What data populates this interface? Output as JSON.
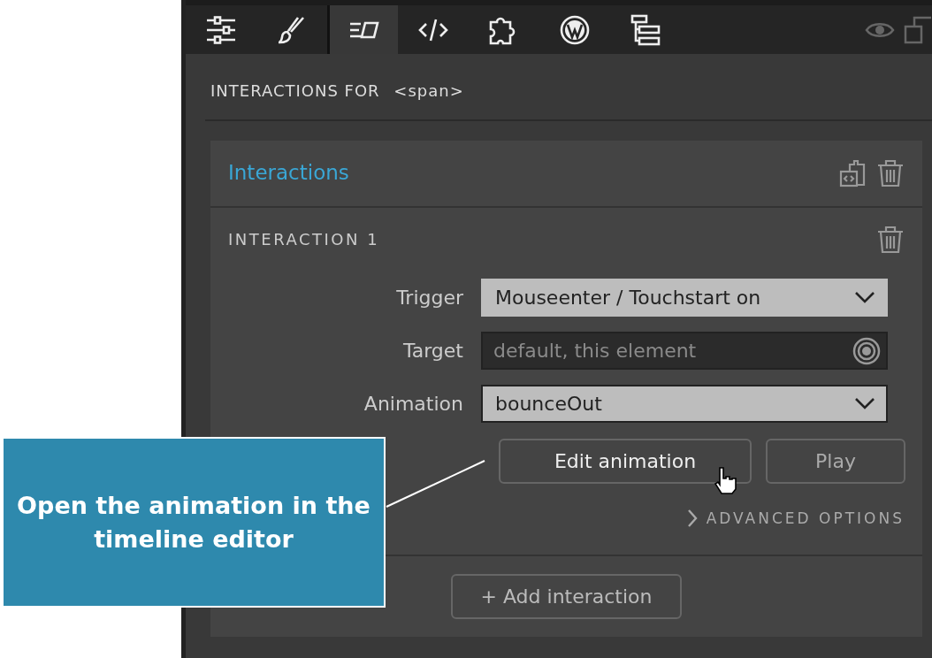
{
  "toolbar": {
    "tabs": [
      {
        "kind": "sliders",
        "selected": false
      },
      {
        "kind": "brush",
        "selected": false
      },
      {
        "kind": "interactions",
        "selected": true
      },
      {
        "kind": "code",
        "selected": false
      },
      {
        "kind": "puzzle",
        "selected": false
      },
      {
        "kind": "wordpress",
        "selected": false
      },
      {
        "kind": "tree",
        "selected": false
      }
    ]
  },
  "panel": {
    "title": "INTERACTIONS FOR",
    "element": "<span>"
  },
  "card": {
    "title": "Interactions",
    "interaction": {
      "title": "INTERACTION 1",
      "fields": [
        {
          "kind": "select",
          "label": "Trigger",
          "value": "Mouseenter / Touchstart on"
        },
        {
          "kind": "target",
          "label": "Target",
          "placeholder": "default, this element"
        },
        {
          "kind": "select",
          "label": "Animation",
          "value": "bounceOut"
        }
      ],
      "buttons": [
        "Edit animation",
        "Play"
      ],
      "advanced": {
        "label": "ADVANCED OPTIONS",
        "expanded": false
      }
    },
    "add_button": "+ Add interaction"
  },
  "callout": {
    "text": "Open the animation in the timeline editor"
  }
}
